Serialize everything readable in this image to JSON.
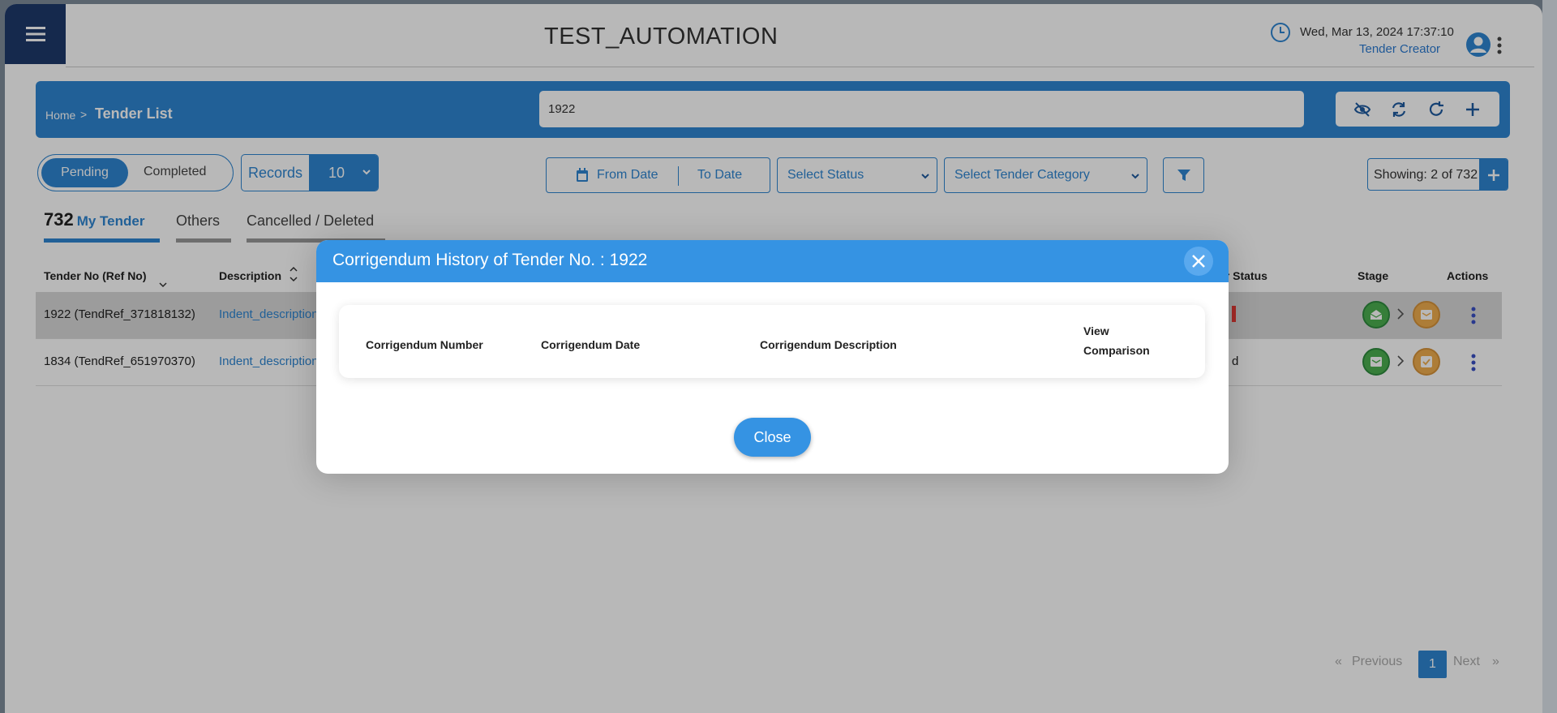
{
  "app": {
    "title": "TEST_AUTOMATION",
    "datetime": "Wed, Mar 13, 2024 17:37:10",
    "role": "Tender Creator"
  },
  "breadcrumb": {
    "home": "Home",
    "separator": ">",
    "current": "Tender List"
  },
  "search": {
    "value": "1922"
  },
  "filters": {
    "pending": "Pending",
    "completed": "Completed",
    "records_label": "Records",
    "records_value": "10",
    "from_date": "From Date",
    "to_date": "To Date",
    "status": "Select Status",
    "category": "Select Tender Category",
    "showing": "Showing: 2 of 732"
  },
  "tabs": {
    "my_count": "732",
    "my_label": "My Tender",
    "others": "Others",
    "cancelled": "Cancelled / Deleted"
  },
  "table": {
    "headers": {
      "tender_no": "Tender No (Ref No)",
      "description": "Description",
      "status_partial": "er Status",
      "stage": "Stage",
      "actions": "Actions"
    },
    "rows": [
      {
        "tender_no": "1922 (TendRef_371818132)",
        "description": "Indent_description",
        "status_partial": ""
      },
      {
        "tender_no": "1834 (TendRef_651970370)",
        "description": "Indent_description",
        "status_partial": "d"
      }
    ]
  },
  "pagination": {
    "first": "«",
    "previous": "Previous",
    "page": "1",
    "next": "Next",
    "last": "»"
  },
  "modal": {
    "title": "Corrigendum History of Tender No. : 1922",
    "columns": {
      "number": "Corrigendum Number",
      "date": "Corrigendum Date",
      "description": "Corrigendum Description",
      "view_1": "View",
      "view_2": "Comparison"
    },
    "close_label": "Close"
  },
  "colors": {
    "primary": "#2f86d1",
    "modal_header": "#3593e3",
    "nav_dark": "#1e3a6b",
    "stage_green": "#4caf50",
    "stage_orange": "#f0ad4e"
  }
}
